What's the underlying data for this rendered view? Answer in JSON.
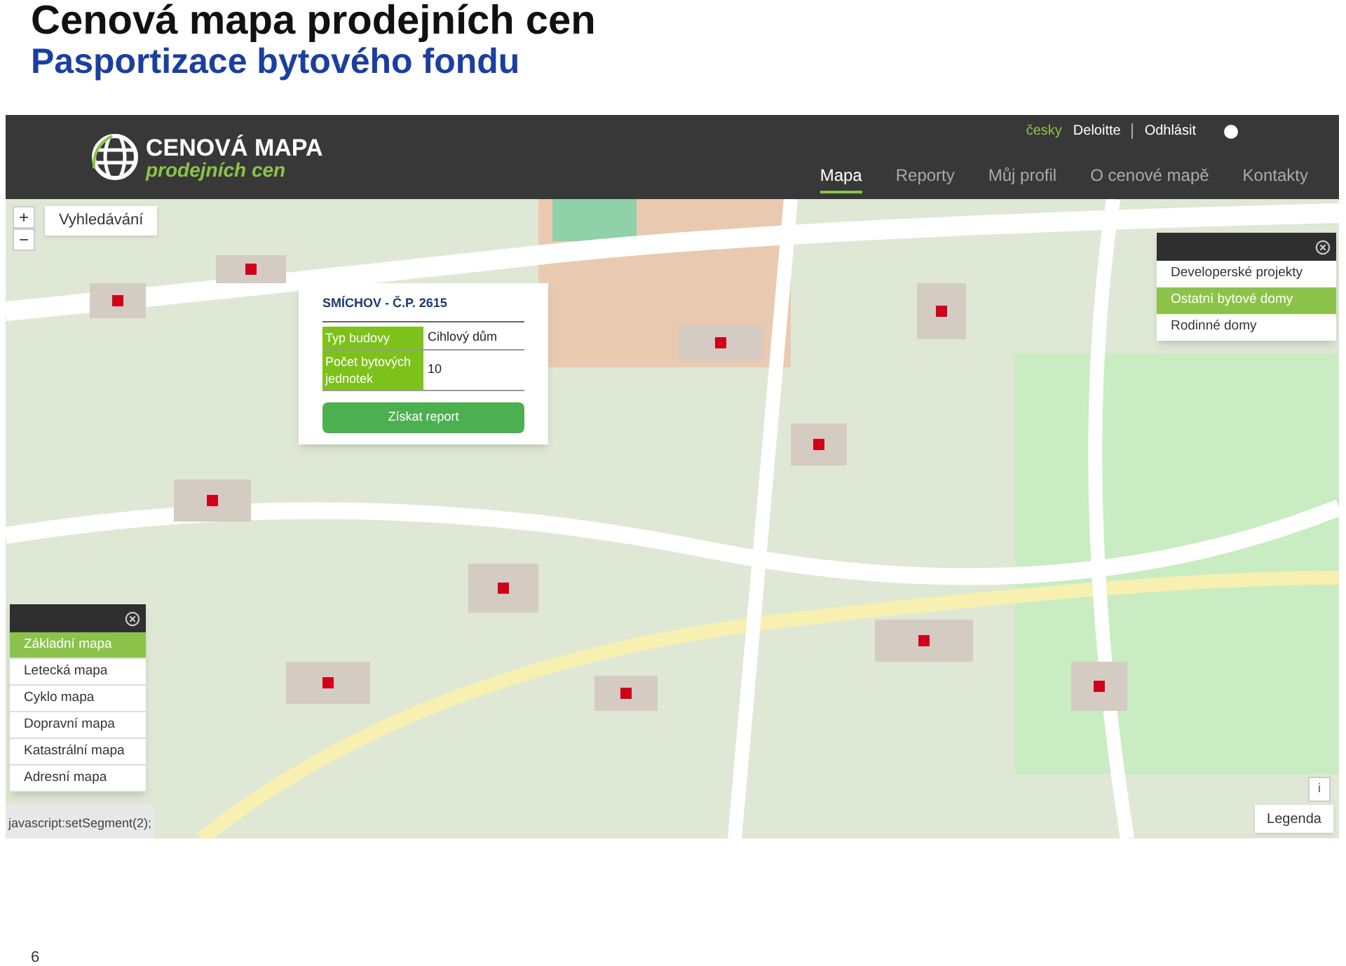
{
  "slide": {
    "title": "Cenová mapa prodejních cen",
    "subtitle": "Pasportizace bytového fondu",
    "page_number": "6"
  },
  "app": {
    "logo": {
      "title": "CENOVÁ MAPA",
      "tagline": "prodejních cen"
    },
    "top_links": [
      {
        "label": "česky",
        "selected": true
      },
      {
        "label": "Deloitte",
        "selected": false
      },
      {
        "label": "Odhlásit",
        "selected": false
      }
    ],
    "nav": [
      {
        "label": "Mapa",
        "selected": true
      },
      {
        "label": "Reporty",
        "selected": false
      },
      {
        "label": "Můj profil",
        "selected": false
      },
      {
        "label": "O cenové mapě",
        "selected": false
      },
      {
        "label": "Kontakty",
        "selected": false
      }
    ],
    "map": {
      "kind": "picture",
      "zoom_in": "+",
      "zoom_out": "−",
      "search_button": "Vyhledávání",
      "popup": {
        "title": "SMÍCHOV - Č.P. 2615",
        "rows": [
          {
            "label": "Typ budovy",
            "value": "Cihlový dům"
          },
          {
            "label": "Počet bytových jednotek",
            "value": "10"
          }
        ],
        "button": "Získat report"
      },
      "categories": [
        {
          "label": "Developerské projekty",
          "selected": false
        },
        {
          "label": "Ostatní bytové domy",
          "selected": true
        },
        {
          "label": "Rodinné domy",
          "selected": false
        }
      ],
      "layers": [
        {
          "label": "Základní mapa",
          "selected": true
        },
        {
          "label": "Letecká mapa",
          "selected": false
        },
        {
          "label": "Cyklo mapa",
          "selected": false
        },
        {
          "label": "Dopravní mapa",
          "selected": false
        },
        {
          "label": "Katastrální mapa",
          "selected": false
        },
        {
          "label": "Adresní mapa",
          "selected": false
        }
      ],
      "info_button": "i",
      "legend_button": "Legenda",
      "status_text": "javascript:setSegment(2);"
    }
  }
}
